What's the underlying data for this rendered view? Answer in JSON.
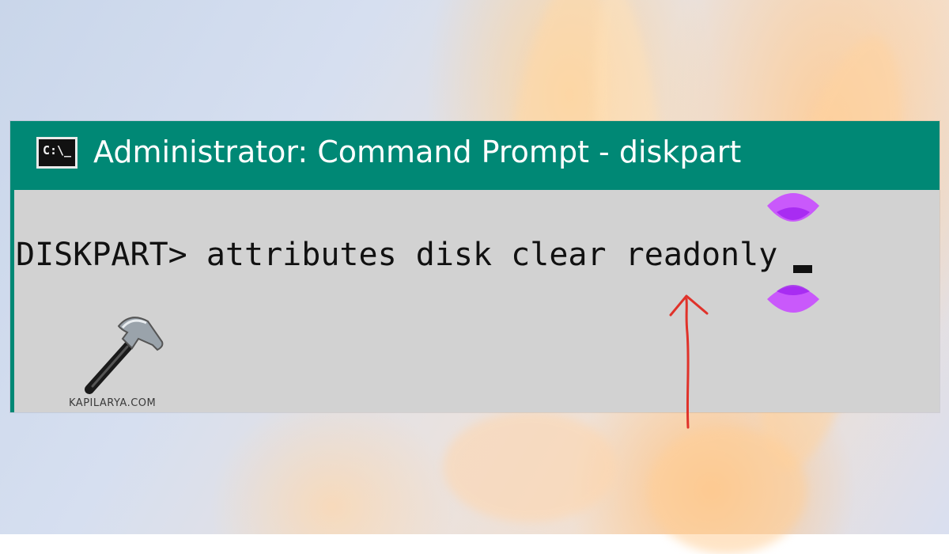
{
  "window": {
    "title": "Administrator: Command Prompt - diskpart",
    "icon_label": "C:\\_"
  },
  "console": {
    "prompt": "DISKPART>",
    "command": "attributes disk clear readonly"
  },
  "watermark": {
    "brand": "KAPILARYA.COM"
  },
  "colors": {
    "titlebar": "#008875",
    "console_bg": "#d2d2d2",
    "arrow": "#e0322a",
    "cursor_marker": "#c84bff"
  }
}
